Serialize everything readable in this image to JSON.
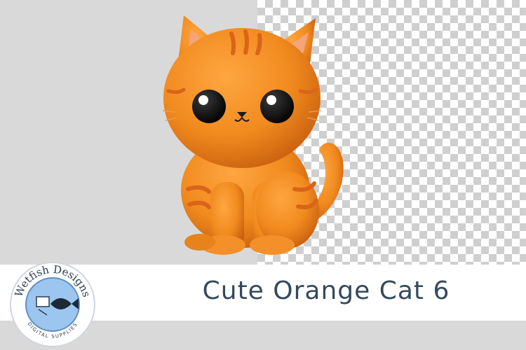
{
  "logo": {
    "brand_top": "Wetfish Designs",
    "brand_bottom": "DIGITAL SUPPLIES"
  },
  "banner": {
    "title": "Cute Orange Cat 6"
  },
  "colors": {
    "cat_orange": "#f08a1e",
    "cat_stripe": "#d9641a",
    "title_text": "#334a5c",
    "logo_blue": "#9cc6ef"
  }
}
